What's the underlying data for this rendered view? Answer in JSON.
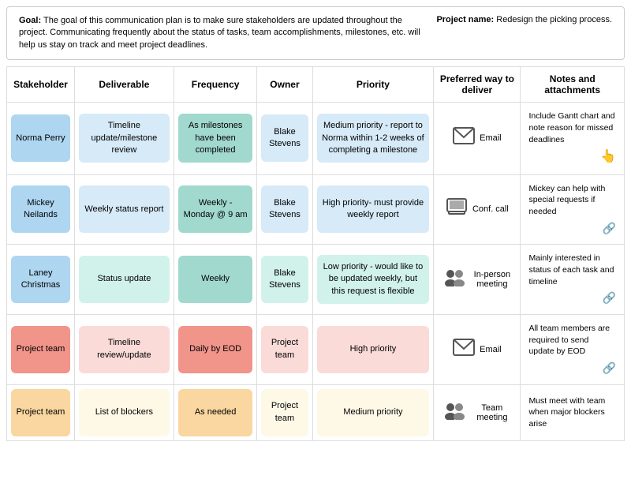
{
  "header": {
    "goal_label": "Goal:",
    "goal_text": "The goal of this communication plan is to make sure stakeholders are updated throughout the project. Communicating frequently about the status of tasks, team accomplishments, milestones, etc. will help us stay on track and meet project deadlines.",
    "project_label": "Project name:",
    "project_value": "Redesign the picking process."
  },
  "table": {
    "headers": [
      "Stakeholder",
      "Deliverable",
      "Frequency",
      "Owner",
      "Priority",
      "Preferred way to deliver",
      "Notes and attachments"
    ],
    "rows": [
      {
        "stakeholder": "Norma Perry",
        "deliverable": "Timeline update/milestone review",
        "frequency": "As milestones have been completed",
        "owner": "Blake Stevens",
        "priority": "Medium priority - report to Norma within 1-2 weeks of completing a milestone",
        "deliver_icon": "✉",
        "deliver_label": "Email",
        "notes": "Include Gantt chart and note reason for missed deadlines",
        "notes_icon": "cursor",
        "stakeholder_color": "blue-card",
        "deliverable_color": "light-blue-card",
        "frequency_color": "teal-card",
        "owner_color": "light-blue-card",
        "priority_color": "light-blue-card"
      },
      {
        "stakeholder": "Mickey Neilands",
        "deliverable": "Weekly status report",
        "frequency": "Weekly - Monday @ 9 am",
        "owner": "Blake Stevens",
        "priority": "High priority- must provide weekly report",
        "deliver_icon": "💻",
        "deliver_label": "Conf. call",
        "notes": "Mickey can help with special requests if needed",
        "notes_icon": "link",
        "stakeholder_color": "blue-card",
        "deliverable_color": "light-blue-card",
        "frequency_color": "teal-card",
        "owner_color": "light-blue-card",
        "priority_color": "light-blue-card"
      },
      {
        "stakeholder": "Laney Christmas",
        "deliverable": "Status update",
        "frequency": "Weekly",
        "owner": "Blake Stevens",
        "priority": "Low priority - would like to be updated weekly, but this request is flexible",
        "deliver_icon": "👥",
        "deliver_label": "In-person meeting",
        "notes": "Mainly interested in status of each task and timeline",
        "notes_icon": "link",
        "stakeholder_color": "blue-card",
        "deliverable_color": "light-teal-card",
        "frequency_color": "teal-card",
        "owner_color": "light-teal-card",
        "priority_color": "light-teal-card"
      },
      {
        "stakeholder": "Project team",
        "deliverable": "Timeline review/update",
        "frequency": "Daily by EOD",
        "owner": "Project team",
        "priority": "High priority",
        "deliver_icon": "✉",
        "deliver_label": "Email",
        "notes": "All team members are required to send update by EOD",
        "notes_icon": "link",
        "stakeholder_color": "pink-card",
        "deliverable_color": "light-pink-card",
        "frequency_color": "pink-card",
        "owner_color": "light-pink-card",
        "priority_color": "light-pink-card"
      },
      {
        "stakeholder": "Project team",
        "deliverable": "List of blockers",
        "frequency": "As needed",
        "owner": "Project team",
        "priority": "Medium priority",
        "deliver_icon": "👥",
        "deliver_label": "Team meeting",
        "notes": "Must meet with team when major blockers arise",
        "notes_icon": "none",
        "stakeholder_color": "yellow-card",
        "deliverable_color": "light-yellow-card",
        "frequency_color": "yellow-card",
        "owner_color": "light-yellow-card",
        "priority_color": "light-yellow-card"
      }
    ]
  }
}
